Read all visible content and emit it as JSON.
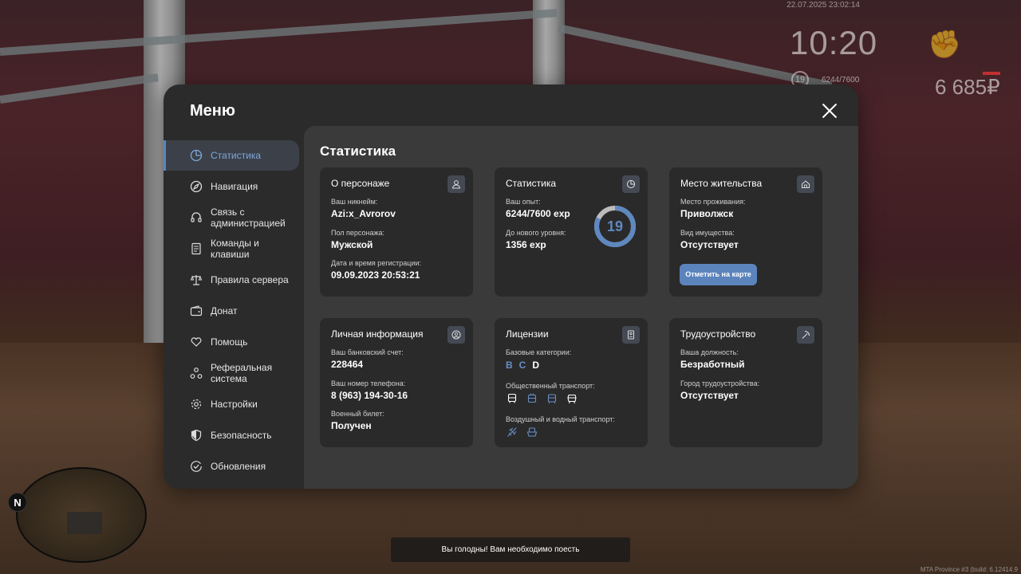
{
  "hud": {
    "datetime": "22.07.2025 23:02:14",
    "time": "10:20",
    "level": "19",
    "exp": "6244/7600",
    "money": "6 685₽",
    "fist_icon": "fist-icon"
  },
  "minimap": {
    "north": "N"
  },
  "notification": "Вы голодны! Вам необходимо поесть",
  "build": "MTA Province #3 (build: 6.12414.9",
  "menu": {
    "title": "Меню",
    "sidebar": [
      {
        "label": "Статистика",
        "icon": "pie-chart-icon",
        "active": true
      },
      {
        "label": "Навигация",
        "icon": "compass-icon"
      },
      {
        "label": "Связь с администрацией",
        "icon": "headset-icon"
      },
      {
        "label": "Команды и клавиши",
        "icon": "document-icon"
      },
      {
        "label": "Правила сервера",
        "icon": "scales-icon"
      },
      {
        "label": "Донат",
        "icon": "wallet-icon"
      },
      {
        "label": "Помощь",
        "icon": "heart-hand-icon"
      },
      {
        "label": "Реферальная система",
        "icon": "referral-icon"
      },
      {
        "label": "Настройки",
        "icon": "gear-icon"
      },
      {
        "label": "Безопасность",
        "icon": "shield-icon"
      },
      {
        "label": "Обновления",
        "icon": "update-check-icon"
      }
    ],
    "content_title": "Статистика",
    "character": {
      "title": "О персонаже",
      "nickname_label": "Ваш никнейм:",
      "nickname": "Azi:x_Avrorov",
      "gender_label": "Пол персонажа:",
      "gender": "Мужской",
      "reg_label": "Дата и время регистрации:",
      "reg": "09.09.2023 20:53:21"
    },
    "stats": {
      "title": "Статистика",
      "exp_label": "Ваш опыт:",
      "exp": "6244/7600 exp",
      "next_label": "До нового уровня:",
      "next": "1356 exp",
      "level": "19",
      "progress": 0.8216
    },
    "residence": {
      "title": "Место жительства",
      "place_label": "Место проживания:",
      "place": "Приволжск",
      "property_label": "Вид имущества:",
      "property": "Отсутствует",
      "map_button": "Отметить на карте"
    },
    "personal": {
      "title": "Личная информация",
      "bank_label": "Ваш банковский счет:",
      "bank": "228464",
      "phone_label": "Ваш номер телефона:",
      "phone": "8 (963) 194-30-16",
      "military_label": "Военный билет:",
      "military": "Получен"
    },
    "licenses": {
      "title": "Лицензии",
      "base_label": "Базовые категории:",
      "categories": [
        "B",
        "C",
        "D"
      ],
      "public_label": "Общественный транспорт:",
      "air_label": "Воздушный и водный транспорт:"
    },
    "job": {
      "title": "Трудоустройство",
      "position_label": "Ваша должность:",
      "position": "Безработный",
      "city_label": "Город трудоустройства:",
      "city": "Отсутствует"
    }
  }
}
